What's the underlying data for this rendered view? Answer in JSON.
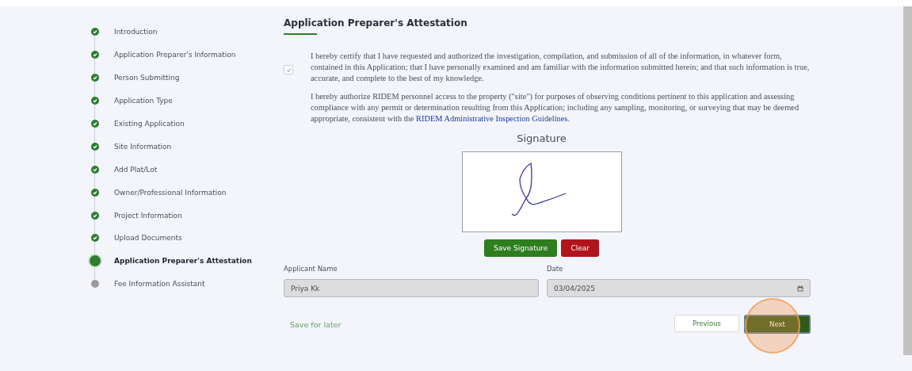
{
  "steps": [
    {
      "label": "Introduction",
      "completed": true,
      "selected": false
    },
    {
      "label": "Application Preparer's Information",
      "completed": true,
      "selected": false
    },
    {
      "label": "Person Submitting",
      "completed": true,
      "selected": false
    },
    {
      "label": "Application Type",
      "completed": true,
      "selected": false
    },
    {
      "label": "Existing Application",
      "completed": true,
      "selected": false
    },
    {
      "label": "Site Information",
      "completed": true,
      "selected": false
    },
    {
      "label": "Add Plat/Lot",
      "completed": true,
      "selected": false
    },
    {
      "label": "Owner/Professional Information",
      "completed": true,
      "selected": false
    },
    {
      "label": "Project Information",
      "completed": true,
      "selected": false
    },
    {
      "label": "Upload Documents",
      "completed": true,
      "selected": false
    },
    {
      "label": "Application Preparer's Attestation",
      "completed": false,
      "selected": true
    },
    {
      "label": "Fee Information Assistant",
      "completed": false,
      "selected": false
    }
  ],
  "section_title": "Application Preparer's Attestation",
  "attestation": {
    "checked": true,
    "paragraph_1": "I hereby certify that I have requested and authorized the investigation, compilation, and submission of all of the information, in whatever form, contained in this Application; that I have personally examined and am familiar with the information submitted herein; and that such information is true, accurate, and complete to the best of my knowledge.",
    "paragraph_2": "I hereby authorize RIDEM personnel access to the property (\"site\") for purposes of observing conditions pertinent to this application and assessing compliance with any permit or determination resulting from this Application; including any sampling, monitoring, or surveying that may be deemed appropriate, consistent with the ",
    "link": "RIDEM Administrative Inspection Guidelines",
    "paragraph_2_end": "."
  },
  "signature": {
    "title": "Signature",
    "save_button": "Save Signature",
    "clear_button": "Clear"
  },
  "fields": [
    {
      "label": "Applicant Name",
      "value": "Priya Kk",
      "kind": "text"
    },
    {
      "label": "Date",
      "value": "03/04/2025",
      "kind": "date"
    }
  ],
  "footer": {
    "save_for_later": "Save for later",
    "previous": "Previous",
    "next": "Next"
  }
}
